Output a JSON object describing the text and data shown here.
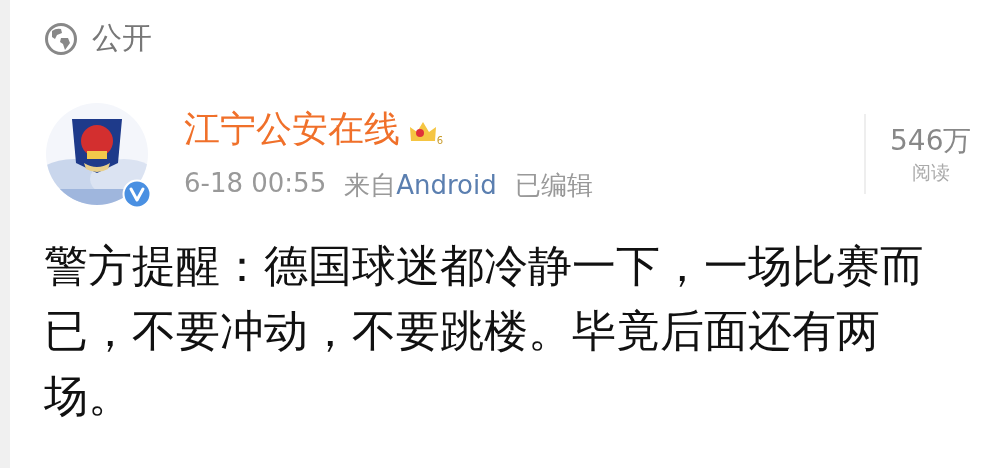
{
  "visibility": {
    "label": "公开"
  },
  "post": {
    "author": "江宁公安在线",
    "vip_level": "6",
    "verified": true,
    "time": "6-18 00:55",
    "source_prefix": "来自",
    "source": "Android",
    "edited": "已编辑",
    "reads": "546万",
    "reads_label": "阅读",
    "text": "警方提醒：德国球迷都冷静一下，一场比赛而已，不要冲动，不要跳楼。毕竟后面还有两场。"
  }
}
